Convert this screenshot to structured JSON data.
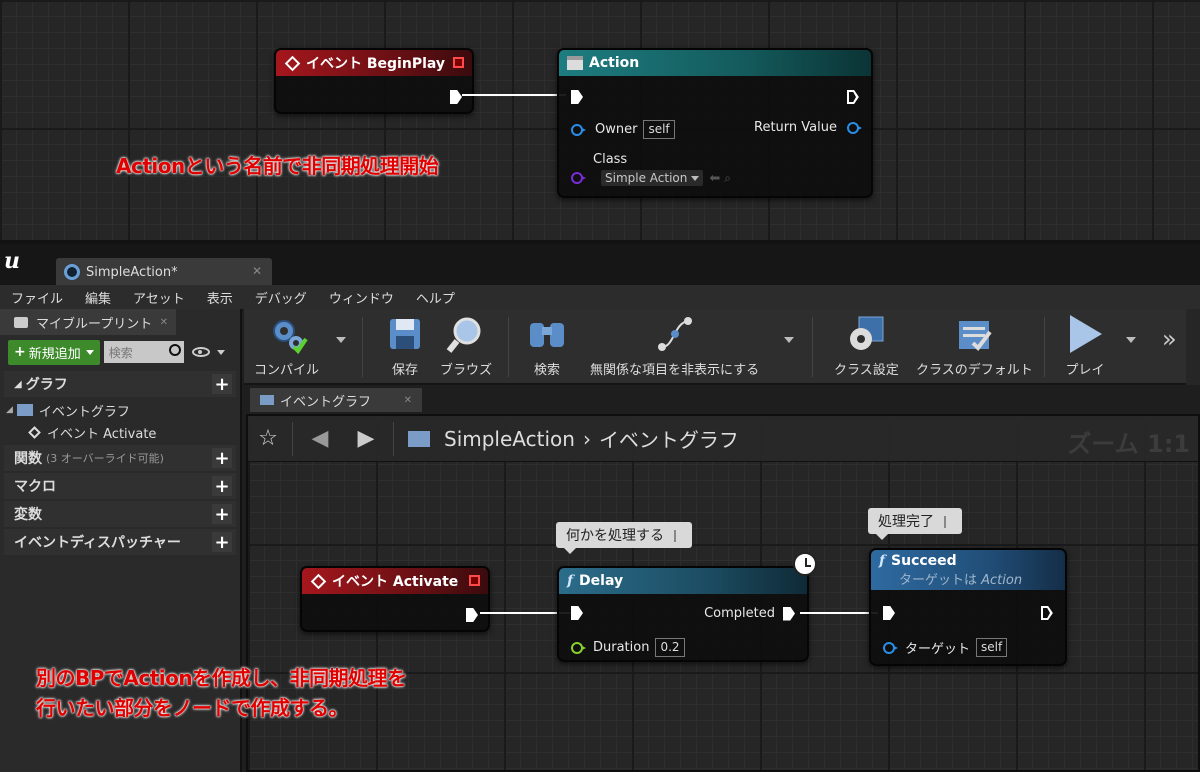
{
  "top_graph": {
    "node_beginplay": {
      "title": "イベント BeginPlay"
    },
    "node_action": {
      "title": "Action",
      "owner_label": "Owner",
      "owner_value": "self",
      "return_label": "Return Value",
      "class_label": "Class",
      "class_value": "Simple Action"
    },
    "annotation": "Actionという名前で非同期処理開始"
  },
  "editor": {
    "doc_tab": "SimpleAction*",
    "menu": [
      "ファイル",
      "編集",
      "アセット",
      "表示",
      "デバッグ",
      "ウィンドウ",
      "ヘルプ"
    ],
    "left_panel": {
      "tab": "マイブループリント",
      "add_new": "新規追加",
      "search_placeholder": "検索",
      "sections": {
        "graph": "グラフ",
        "event_graph": "イベントグラフ",
        "event_activate": "イベント Activate",
        "functions": "関数",
        "functions_count": "(3 オーバーライド可能)",
        "macros": "マクロ",
        "variables": "変数",
        "dispatchers": "イベントディスパッチャー"
      }
    },
    "toolbar": {
      "compile": "コンパイル",
      "save": "保存",
      "browse": "ブラウズ",
      "find": "検索",
      "hide_unrelated": "無関係な項目を非表示にする",
      "class_settings": "クラス設定",
      "class_defaults": "クラスのデフォルト",
      "play": "プレイ"
    },
    "graph_tab": "イベントグラフ",
    "breadcrumb": {
      "blueprint": "SimpleAction",
      "graph": "イベントグラフ"
    },
    "zoom": "ズーム 1:1",
    "nodes": {
      "activate": {
        "title": "イベント Activate"
      },
      "delay": {
        "title": "Delay",
        "comment": "何かを処理する",
        "completed_label": "Completed",
        "duration_label": "Duration",
        "duration_value": "0.2"
      },
      "succeed": {
        "title": "Succeed",
        "comment": "処理完了",
        "subtitle_prefix": "ターゲットは ",
        "subtitle_target": "Action",
        "target_label": "ターゲット",
        "target_value": "self"
      }
    },
    "annotation_line1": "別のBPでActionを作成し、非同期処理を",
    "annotation_line2": "行いたい部分をノードで作成する。"
  },
  "colors": {
    "event_header": "#a5171d",
    "call_header": "#1d7d80",
    "func_header": "#2e6aa0",
    "object_pin": "#2a8ee8",
    "class_pin": "#7a2bd8",
    "float_pin": "#88d12f",
    "annotation": "#e10000",
    "add_button": "#3c8a2a"
  }
}
